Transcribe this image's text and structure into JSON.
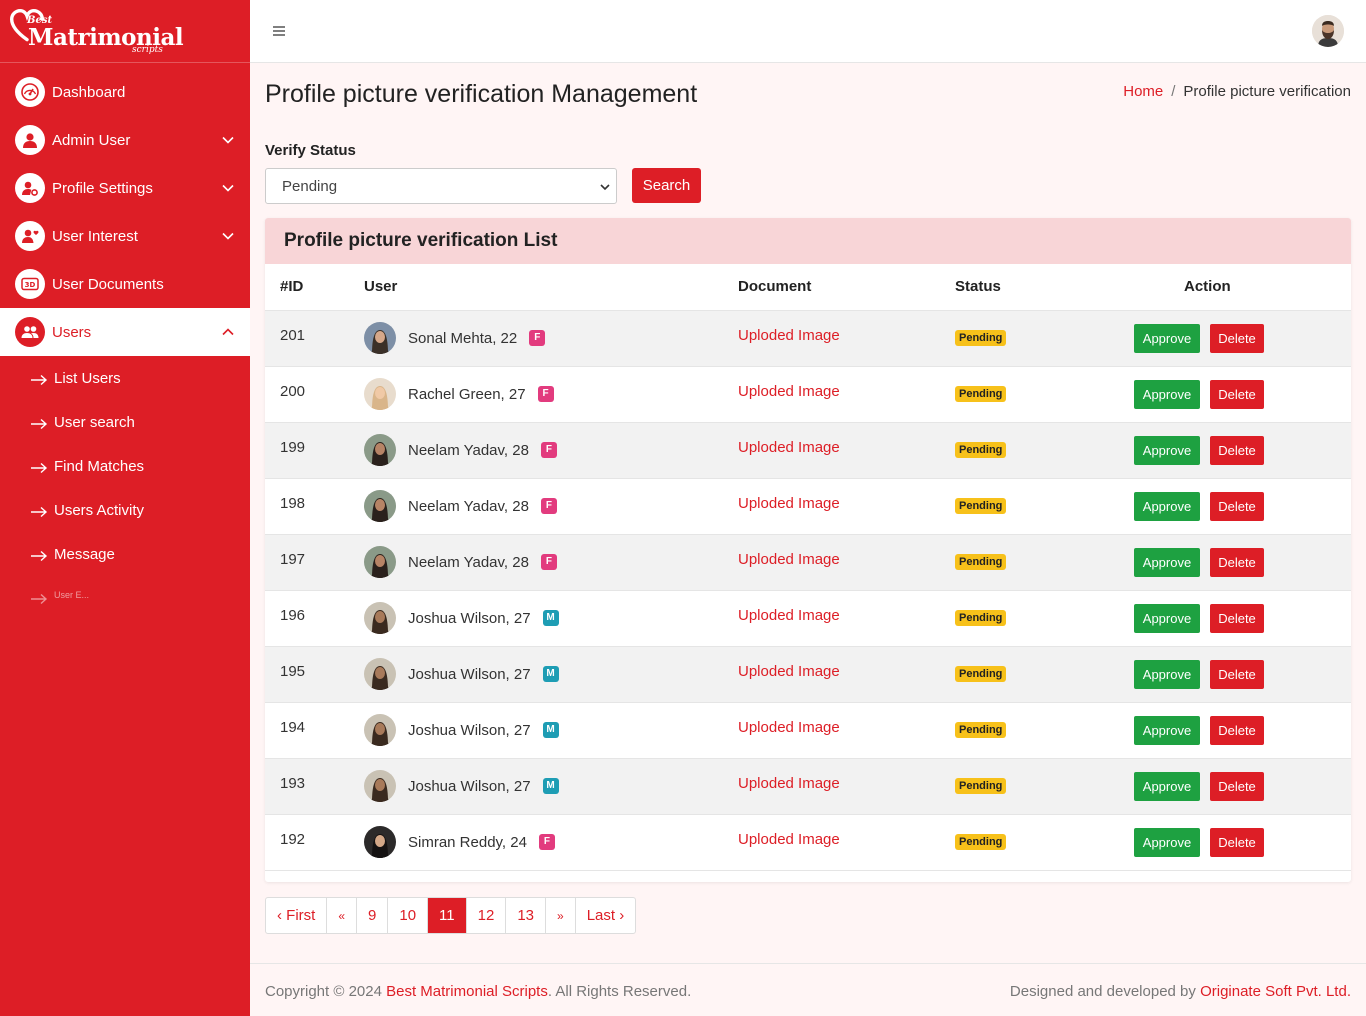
{
  "brand": {
    "best": "Best",
    "name": "Matrimonial",
    "scripts": "scripts"
  },
  "sidebar": {
    "items": [
      {
        "label": "Dashboard",
        "icon": "dashboard-gauge-icon"
      },
      {
        "label": "Admin User",
        "icon": "user-icon"
      },
      {
        "label": "Profile Settings",
        "icon": "user-settings-icon"
      },
      {
        "label": "User Interest",
        "icon": "user-heart-icon"
      },
      {
        "label": "User Documents",
        "icon": "3d-icon"
      },
      {
        "label": "Users",
        "icon": "users-icon"
      }
    ],
    "sub_items": [
      {
        "label": "List Users"
      },
      {
        "label": "User search"
      },
      {
        "label": "Find Matches"
      },
      {
        "label": "Users Activity"
      },
      {
        "label": "Message"
      },
      {
        "label": "User E..."
      }
    ]
  },
  "header": {
    "title": "Profile picture verification Management",
    "breadcrumb": {
      "home": "Home",
      "sep": "/",
      "current": "Profile picture verification"
    }
  },
  "filter": {
    "label": "Verify Status",
    "selected": "Pending",
    "search_label": "Search"
  },
  "list": {
    "title": "Profile picture verification List",
    "columns": [
      "#ID",
      "User",
      "Document",
      "Status",
      "Action"
    ],
    "rows": [
      {
        "id": "201",
        "user": "Sonal Mehta, 22",
        "gender": "F",
        "document": "Uploded Image",
        "status": "Pending",
        "approve": "Approve",
        "delete": "Delete"
      },
      {
        "id": "200",
        "user": "Rachel Green, 27",
        "gender": "F",
        "document": "Uploded Image",
        "status": "Pending",
        "approve": "Approve",
        "delete": "Delete"
      },
      {
        "id": "199",
        "user": "Neelam Yadav, 28",
        "gender": "F",
        "document": "Uploded Image",
        "status": "Pending",
        "approve": "Approve",
        "delete": "Delete"
      },
      {
        "id": "198",
        "user": "Neelam Yadav, 28",
        "gender": "F",
        "document": "Uploded Image",
        "status": "Pending",
        "approve": "Approve",
        "delete": "Delete"
      },
      {
        "id": "197",
        "user": "Neelam Yadav, 28",
        "gender": "F",
        "document": "Uploded Image",
        "status": "Pending",
        "approve": "Approve",
        "delete": "Delete"
      },
      {
        "id": "196",
        "user": "Joshua Wilson, 27",
        "gender": "M",
        "document": "Uploded Image",
        "status": "Pending",
        "approve": "Approve",
        "delete": "Delete"
      },
      {
        "id": "195",
        "user": "Joshua Wilson, 27",
        "gender": "M",
        "document": "Uploded Image",
        "status": "Pending",
        "approve": "Approve",
        "delete": "Delete"
      },
      {
        "id": "194",
        "user": "Joshua Wilson, 27",
        "gender": "M",
        "document": "Uploded Image",
        "status": "Pending",
        "approve": "Approve",
        "delete": "Delete"
      },
      {
        "id": "193",
        "user": "Joshua Wilson, 27",
        "gender": "M",
        "document": "Uploded Image",
        "status": "Pending",
        "approve": "Approve",
        "delete": "Delete"
      },
      {
        "id": "192",
        "user": "Simran Reddy, 24",
        "gender": "F",
        "document": "Uploded Image",
        "status": "Pending",
        "approve": "Approve",
        "delete": "Delete"
      }
    ]
  },
  "pagination": {
    "items": [
      "‹ First",
      "«",
      "9",
      "10",
      "11",
      "12",
      "13",
      "»",
      "Last ›"
    ],
    "active": "11"
  },
  "footer": {
    "copyright_prefix": "Copyright © 2024",
    "company": "Best Matrimonial Scripts",
    "rights": ". All Rights Reserved.",
    "designed_by": "Designed and developed by",
    "developer": "Originate Soft Pvt. Ltd."
  },
  "colors": {
    "primary": "#dd1e26",
    "approve": "#1ea141",
    "pending_badge": "#f7c11a",
    "female_badge": "#e23b7e",
    "male_badge": "#1e9db4",
    "card_header": "#f8d5d7"
  }
}
